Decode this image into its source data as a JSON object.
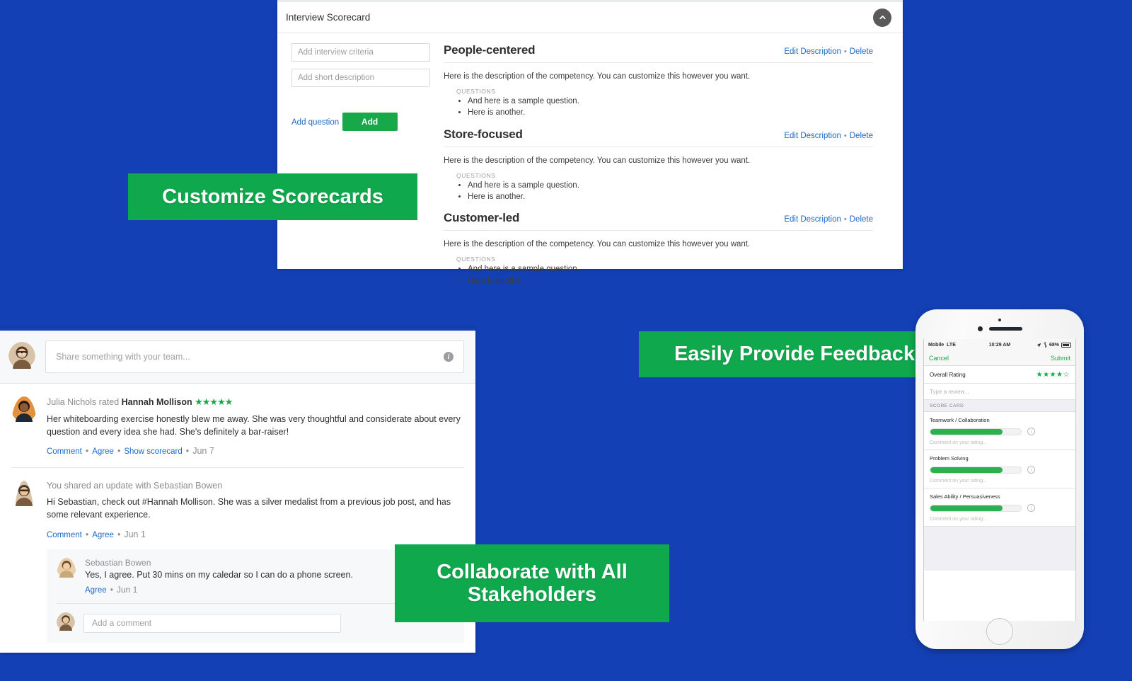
{
  "theme": {
    "background_blue": "#1340b5",
    "accent_green": "#10a84d",
    "button_green": "#17a84a",
    "link_blue": "#1b6ac9"
  },
  "scorecard": {
    "title": "Interview Scorecard",
    "collapse_icon": "chevron-up-icon",
    "form": {
      "criteria_placeholder": "Add interview criteria",
      "criteria_value": "",
      "description_placeholder": "Add short description",
      "description_value": "",
      "add_question_label": "Add question",
      "add_button_label": "Add"
    },
    "questions_label": "QUESTIONS",
    "edit_label": "Edit Description",
    "delete_label": "Delete",
    "separator": "•",
    "competencies": [
      {
        "name": "People-centered",
        "description": "Here is the description of the competency. You can customize this however you want.",
        "questions": [
          "And here is a sample question.",
          "Here is another."
        ]
      },
      {
        "name": "Store-focused",
        "description": "Here is the description of the competency. You can customize this however you want.",
        "questions": [
          "And here is a sample question.",
          "Here is another."
        ]
      },
      {
        "name": "Customer-led",
        "description": "Here is the description of the competency. You can customize this however you want.",
        "questions": [
          "And here is a sample question.",
          "Here is another."
        ]
      }
    ]
  },
  "feed": {
    "composer": {
      "placeholder": "Share something with your team...",
      "value": "",
      "info_icon": "info-icon"
    },
    "posts": [
      {
        "author": "Julia Nichols",
        "header_verb": "rated",
        "subject": "Hannah Mollison",
        "stars": "★★★★★",
        "star_count": 5,
        "body": "Her whiteboarding exercise honestly blew me away. She was very thoughtful and considerate about every question and every idea she had. She's definitely a bar-raiser!",
        "actions": [
          "Comment",
          "Agree",
          "Show scorecard"
        ],
        "date": "Jun 7"
      },
      {
        "header_text": "You shared an update with Sebastian Bowen",
        "body": "Hi Sebastian, check out #Hannah Mollison. She was a silver medalist from a previous job post, and has some relevant experience.",
        "actions": [
          "Comment",
          "Agree"
        ],
        "date": "Jun 1",
        "reply": {
          "author": "Sebastian Bowen",
          "text": "Yes, I agree. Put 30 mins on my caledar so I can do a phone screen.",
          "action": "Agree",
          "date": "Jun 1"
        },
        "add_comment_placeholder": "Add a comment",
        "add_comment_value": ""
      }
    ]
  },
  "banners": {
    "customize": "Customize Scorecards",
    "feedback": "Easily Provide Feedback",
    "collaborate_line1": "Collaborate with All",
    "collaborate_line2": "Stakeholders"
  },
  "phone": {
    "status": {
      "carrier": "Mobile",
      "network": "LTE",
      "time": "10:29 AM",
      "battery": "68%",
      "location_icon": "location-arrow-icon",
      "bluetooth_icon": "bluetooth-icon"
    },
    "nav": {
      "cancel_label": "Cancel",
      "submit_label": "Submit"
    },
    "overall": {
      "label": "Overall Rating",
      "stars": "★★★★☆",
      "value": 4,
      "max": 5
    },
    "review_placeholder": "Type a review...",
    "section_label": "SCORE CARD",
    "comment_placeholder": "Comment on your rating...",
    "criteria": [
      {
        "name": "Teamwork / Collaboration",
        "fill_percent": 80,
        "info_icon": "info-circle-icon"
      },
      {
        "name": "Problem Solving",
        "fill_percent": 80,
        "info_icon": "info-circle-icon"
      },
      {
        "name": "Sales Ability / Persuasiveness",
        "fill_percent": 80,
        "info_icon": "info-circle-icon"
      }
    ]
  }
}
